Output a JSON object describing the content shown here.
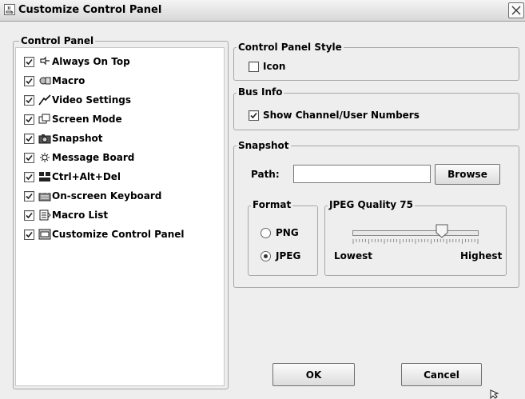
{
  "window": {
    "title": "Customize Control Panel"
  },
  "control_panel": {
    "title": "Control Panel",
    "items": [
      {
        "label": "Always On Top",
        "checked": true,
        "icon": "pin-icon"
      },
      {
        "label": "Macro",
        "checked": true,
        "icon": "macro-icon"
      },
      {
        "label": "Video Settings",
        "checked": true,
        "icon": "video-settings-icon"
      },
      {
        "label": "Screen Mode",
        "checked": true,
        "icon": "screen-mode-icon"
      },
      {
        "label": "Snapshot",
        "checked": true,
        "icon": "camera-icon"
      },
      {
        "label": "Message Board",
        "checked": true,
        "icon": "message-board-icon"
      },
      {
        "label": "Ctrl+Alt+Del",
        "checked": true,
        "icon": "ctrl-alt-del-icon"
      },
      {
        "label": "On-screen Keyboard",
        "checked": true,
        "icon": "keyboard-icon"
      },
      {
        "label": "Macro List",
        "checked": true,
        "icon": "macro-list-icon"
      },
      {
        "label": "Customize Control Panel",
        "checked": true,
        "icon": "customize-icon"
      }
    ]
  },
  "control_panel_style": {
    "title": "Control Panel Style",
    "icon_label": "Icon",
    "icon_checked": false
  },
  "bus_info": {
    "title": "Bus Info",
    "show_numbers_label": "Show Channel/User Numbers",
    "show_numbers_checked": true
  },
  "snapshot": {
    "title": "Snapshot",
    "path_label": "Path:",
    "path_value": "",
    "browse_label": "Browse",
    "format": {
      "title": "Format",
      "options": [
        "PNG",
        "JPEG"
      ],
      "selected": "JPEG"
    },
    "jpeg_quality": {
      "title": "JPEG Quality 75",
      "value": 75,
      "min_label": "Lowest",
      "max_label": "Highest"
    }
  },
  "buttons": {
    "ok": "OK",
    "cancel": "Cancel"
  }
}
